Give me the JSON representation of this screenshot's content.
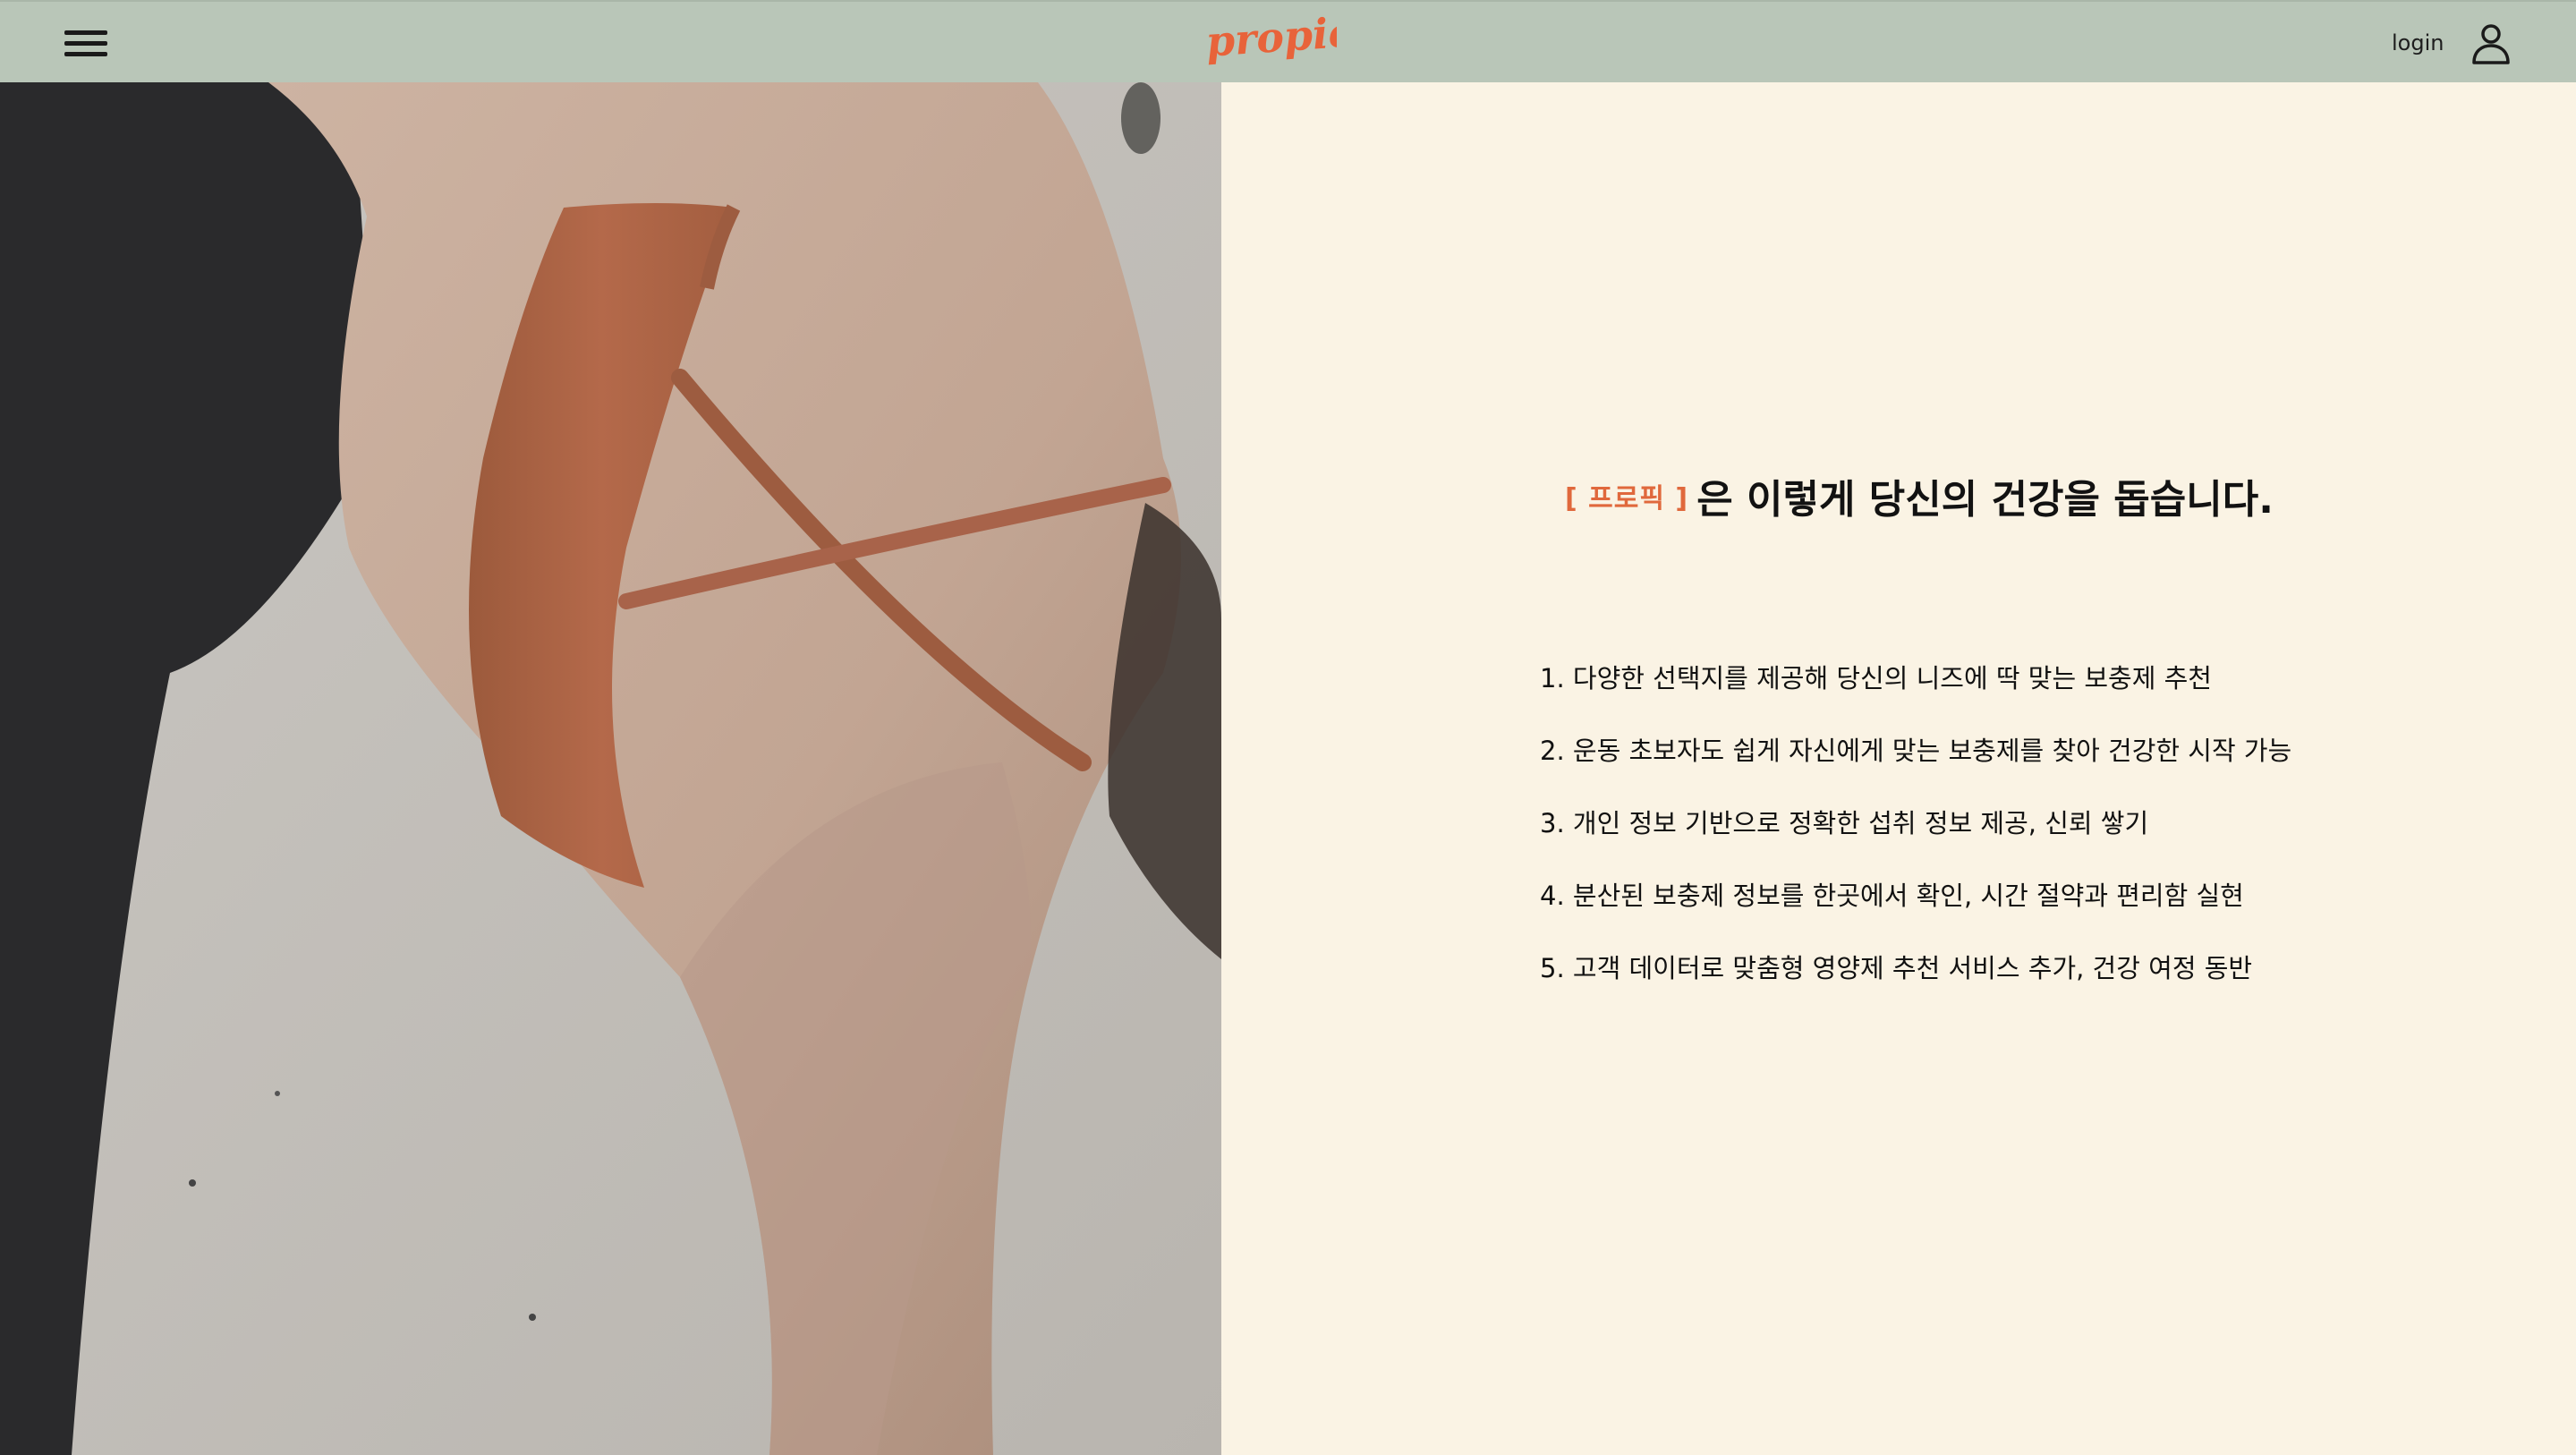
{
  "header": {
    "menu_icon": "hamburger-menu-icon",
    "logo_text": "propick",
    "login_label": "login",
    "user_icon": "user-icon"
  },
  "hero": {
    "icon": "hero-photo"
  },
  "main": {
    "brand_tag": "[ 프로픽 ]",
    "headline": "은 이렇게 당신의 건강을 돕습니다.",
    "features": [
      "1. 다양한 선택지를 제공해 당신의 니즈에 딱 맞는 보충제 추천",
      "2. 운동 초보자도 쉽게 자신에게 맞는 보충제를 찾아 건강한 시작 가능",
      "3. 개인 정보 기반으로 정확한 섭취 정보 제공, 신뢰 쌓기",
      "4. 분산된 보충제 정보를 한곳에서 확인, 시간 절약과 편리함 실현",
      "5. 고객 데이터로 맞춤형 영양제 추천 서비스 추가, 건강 여정 동반"
    ]
  },
  "colors": {
    "header_bg": "#b9c6b8",
    "content_bg": "#faf3e4",
    "accent": "#e0683c",
    "text": "#111111"
  }
}
